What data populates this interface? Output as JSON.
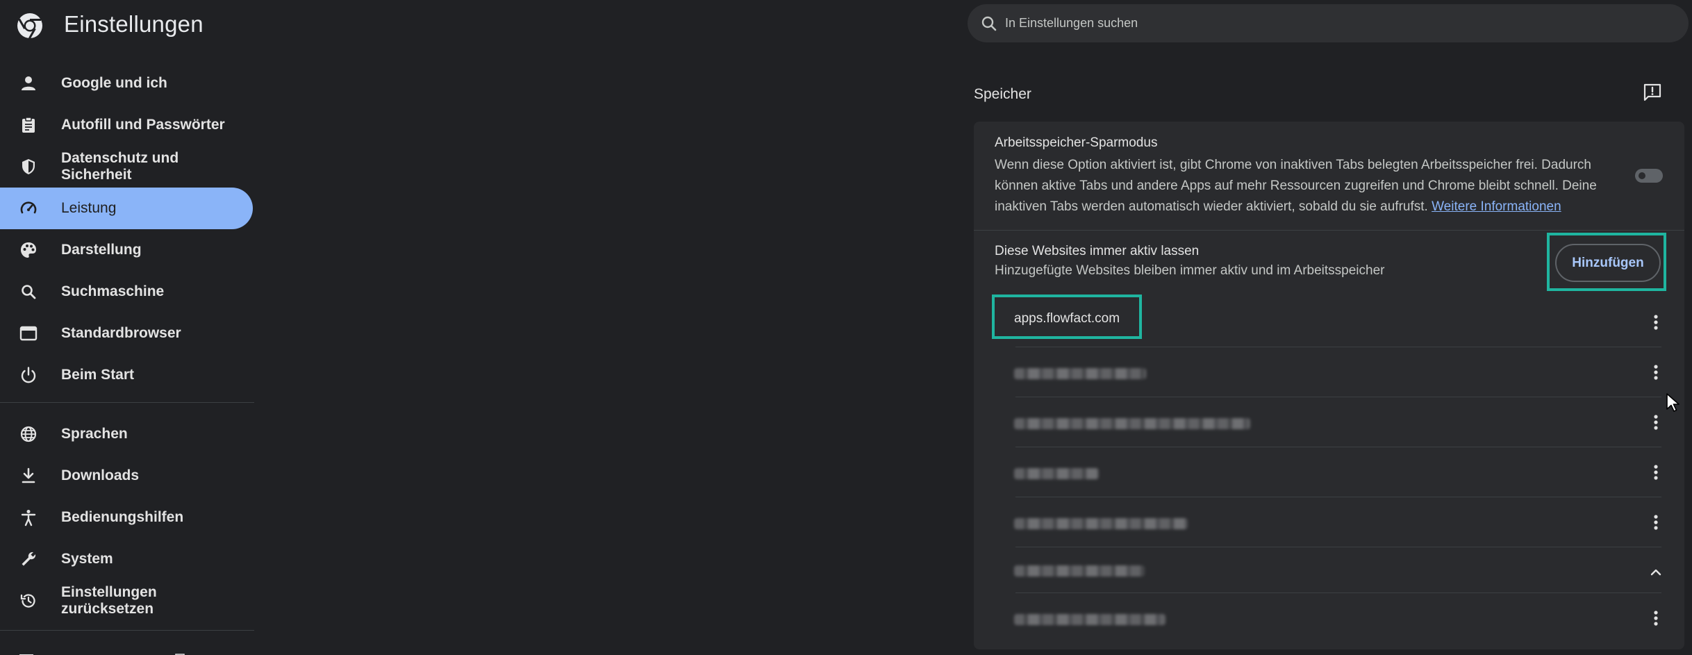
{
  "header": {
    "title": "Einstellungen",
    "search_placeholder": "In Einstellungen suchen"
  },
  "sidebar": {
    "items": [
      {
        "label": "Google und ich",
        "icon": "person-icon"
      },
      {
        "label": "Autofill und Passwörter",
        "icon": "clipboard-icon"
      },
      {
        "label": "Datenschutz und Sicherheit",
        "icon": "shield-icon"
      },
      {
        "label": "Leistung",
        "icon": "speedometer-icon",
        "active": true
      },
      {
        "label": "Darstellung",
        "icon": "palette-icon"
      },
      {
        "label": "Suchmaschine",
        "icon": "search-icon"
      },
      {
        "label": "Standardbrowser",
        "icon": "browser-window-icon"
      },
      {
        "label": "Beim Start",
        "icon": "power-icon"
      },
      {
        "label": "Sprachen",
        "icon": "globe-icon"
      },
      {
        "label": "Downloads",
        "icon": "download-icon"
      },
      {
        "label": "Bedienungshilfen",
        "icon": "accessibility-icon"
      },
      {
        "label": "System",
        "icon": "wrench-icon"
      },
      {
        "label": "Einstellungen zurücksetzen",
        "icon": "history-icon"
      }
    ]
  },
  "main": {
    "section_title": "Speicher",
    "memory_saver": {
      "title": "Arbeitsspeicher-Sparmodus",
      "description": "Wenn diese Option aktiviert ist, gibt Chrome von inaktiven Tabs belegten Arbeitsspeicher frei. Dadurch können aktive Tabs und andere Apps auf mehr Ressourcen zugreifen und Chrome bleibt schnell. Deine inaktiven Tabs werden automatisch wieder aktiviert, sobald du sie aufrufst.",
      "link": "Weitere Informationen",
      "enabled": false
    },
    "always_active": {
      "title": "Diese Websites immer aktiv lassen",
      "description": "Hinzugefügte Websites bleiben immer aktiv und im Arbeitsspeicher",
      "add_button": "Hinzufügen"
    },
    "sites": [
      {
        "name": "apps.flowfact.com",
        "blurred": false
      },
      {
        "blurred": true
      },
      {
        "blurred": true
      },
      {
        "blurred": true
      },
      {
        "blurred": true
      },
      {
        "blurred": true,
        "expanded": true
      },
      {
        "blurred": true
      }
    ]
  },
  "colors": {
    "background": "#202124",
    "card": "#2a2b2e",
    "accent": "#8ab4f8",
    "highlight": "#1fb5a0"
  }
}
